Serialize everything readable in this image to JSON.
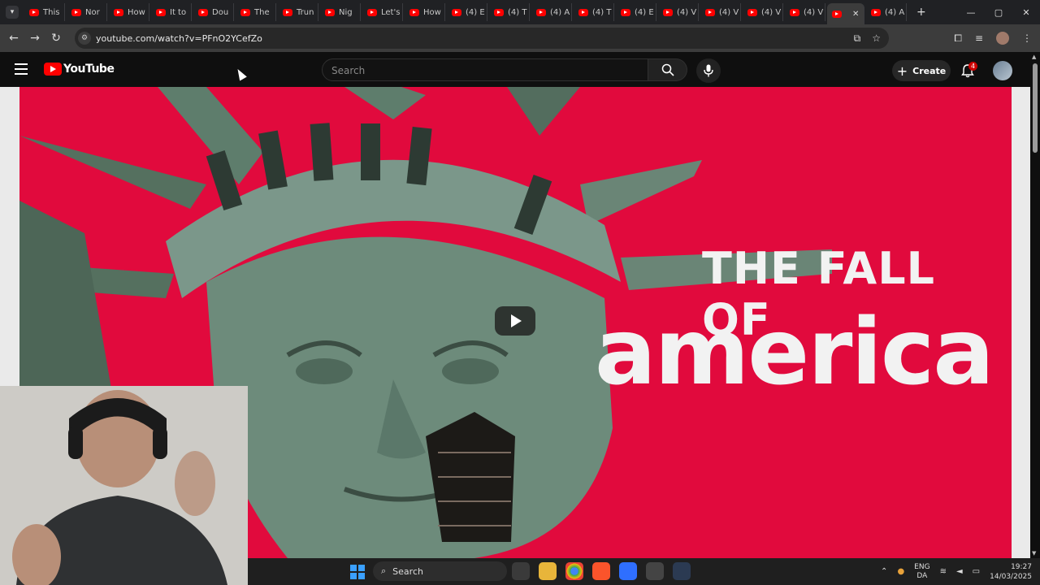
{
  "browser": {
    "tabs": [
      {
        "title": "This"
      },
      {
        "title": "Nor"
      },
      {
        "title": "How"
      },
      {
        "title": "It to"
      },
      {
        "title": "Dou"
      },
      {
        "title": "The"
      },
      {
        "title": "Trun"
      },
      {
        "title": "Nig"
      },
      {
        "title": "Let's"
      },
      {
        "title": "How"
      },
      {
        "title": "(4) E"
      },
      {
        "title": "(4) T"
      },
      {
        "title": "(4) A"
      },
      {
        "title": "(4) T"
      },
      {
        "title": "(4) E"
      },
      {
        "title": "(4) V"
      },
      {
        "title": "(4) V"
      },
      {
        "title": "(4) V"
      },
      {
        "title": "(4) V"
      }
    ],
    "active_tab_close": "✕",
    "after_tab": {
      "title": "(4) A"
    },
    "new_tab_symbol": "+",
    "url": "youtube.com/watch?v=PFnO2YCefZo",
    "window_controls": {
      "minimize": "—",
      "maximize": "▢",
      "close": "✕"
    }
  },
  "youtube": {
    "logo_text": "YouTube",
    "search_placeholder": "Search",
    "create_label": "Create",
    "notification_count": "4"
  },
  "video": {
    "thumbnail_line1": "THE FALL OF",
    "thumbnail_line2": "america"
  },
  "taskbar": {
    "search_label": "Search",
    "lang_top": "ENG",
    "lang_bottom": "DA",
    "time": "19:27",
    "date": "14/03/2025"
  },
  "colors": {
    "youtube_red": "#ff0000",
    "thumbnail_red": "#e10a3d",
    "statue_green": "#5e7d6c"
  }
}
